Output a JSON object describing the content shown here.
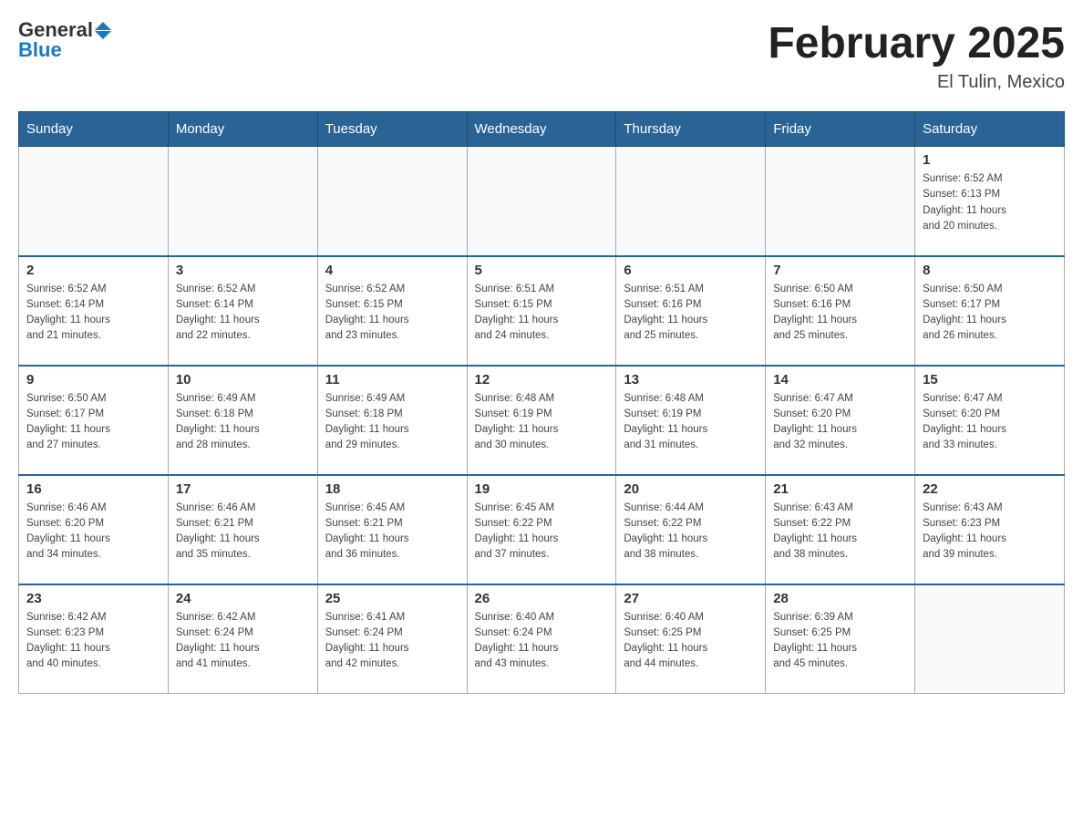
{
  "logo": {
    "general": "General",
    "blue": "Blue"
  },
  "title": "February 2025",
  "location": "El Tulin, Mexico",
  "days_of_week": [
    "Sunday",
    "Monday",
    "Tuesday",
    "Wednesday",
    "Thursday",
    "Friday",
    "Saturday"
  ],
  "weeks": [
    [
      {
        "day": "",
        "info": ""
      },
      {
        "day": "",
        "info": ""
      },
      {
        "day": "",
        "info": ""
      },
      {
        "day": "",
        "info": ""
      },
      {
        "day": "",
        "info": ""
      },
      {
        "day": "",
        "info": ""
      },
      {
        "day": "1",
        "info": "Sunrise: 6:52 AM\nSunset: 6:13 PM\nDaylight: 11 hours\nand 20 minutes."
      }
    ],
    [
      {
        "day": "2",
        "info": "Sunrise: 6:52 AM\nSunset: 6:14 PM\nDaylight: 11 hours\nand 21 minutes."
      },
      {
        "day": "3",
        "info": "Sunrise: 6:52 AM\nSunset: 6:14 PM\nDaylight: 11 hours\nand 22 minutes."
      },
      {
        "day": "4",
        "info": "Sunrise: 6:52 AM\nSunset: 6:15 PM\nDaylight: 11 hours\nand 23 minutes."
      },
      {
        "day": "5",
        "info": "Sunrise: 6:51 AM\nSunset: 6:15 PM\nDaylight: 11 hours\nand 24 minutes."
      },
      {
        "day": "6",
        "info": "Sunrise: 6:51 AM\nSunset: 6:16 PM\nDaylight: 11 hours\nand 25 minutes."
      },
      {
        "day": "7",
        "info": "Sunrise: 6:50 AM\nSunset: 6:16 PM\nDaylight: 11 hours\nand 25 minutes."
      },
      {
        "day": "8",
        "info": "Sunrise: 6:50 AM\nSunset: 6:17 PM\nDaylight: 11 hours\nand 26 minutes."
      }
    ],
    [
      {
        "day": "9",
        "info": "Sunrise: 6:50 AM\nSunset: 6:17 PM\nDaylight: 11 hours\nand 27 minutes."
      },
      {
        "day": "10",
        "info": "Sunrise: 6:49 AM\nSunset: 6:18 PM\nDaylight: 11 hours\nand 28 minutes."
      },
      {
        "day": "11",
        "info": "Sunrise: 6:49 AM\nSunset: 6:18 PM\nDaylight: 11 hours\nand 29 minutes."
      },
      {
        "day": "12",
        "info": "Sunrise: 6:48 AM\nSunset: 6:19 PM\nDaylight: 11 hours\nand 30 minutes."
      },
      {
        "day": "13",
        "info": "Sunrise: 6:48 AM\nSunset: 6:19 PM\nDaylight: 11 hours\nand 31 minutes."
      },
      {
        "day": "14",
        "info": "Sunrise: 6:47 AM\nSunset: 6:20 PM\nDaylight: 11 hours\nand 32 minutes."
      },
      {
        "day": "15",
        "info": "Sunrise: 6:47 AM\nSunset: 6:20 PM\nDaylight: 11 hours\nand 33 minutes."
      }
    ],
    [
      {
        "day": "16",
        "info": "Sunrise: 6:46 AM\nSunset: 6:20 PM\nDaylight: 11 hours\nand 34 minutes."
      },
      {
        "day": "17",
        "info": "Sunrise: 6:46 AM\nSunset: 6:21 PM\nDaylight: 11 hours\nand 35 minutes."
      },
      {
        "day": "18",
        "info": "Sunrise: 6:45 AM\nSunset: 6:21 PM\nDaylight: 11 hours\nand 36 minutes."
      },
      {
        "day": "19",
        "info": "Sunrise: 6:45 AM\nSunset: 6:22 PM\nDaylight: 11 hours\nand 37 minutes."
      },
      {
        "day": "20",
        "info": "Sunrise: 6:44 AM\nSunset: 6:22 PM\nDaylight: 11 hours\nand 38 minutes."
      },
      {
        "day": "21",
        "info": "Sunrise: 6:43 AM\nSunset: 6:22 PM\nDaylight: 11 hours\nand 38 minutes."
      },
      {
        "day": "22",
        "info": "Sunrise: 6:43 AM\nSunset: 6:23 PM\nDaylight: 11 hours\nand 39 minutes."
      }
    ],
    [
      {
        "day": "23",
        "info": "Sunrise: 6:42 AM\nSunset: 6:23 PM\nDaylight: 11 hours\nand 40 minutes."
      },
      {
        "day": "24",
        "info": "Sunrise: 6:42 AM\nSunset: 6:24 PM\nDaylight: 11 hours\nand 41 minutes."
      },
      {
        "day": "25",
        "info": "Sunrise: 6:41 AM\nSunset: 6:24 PM\nDaylight: 11 hours\nand 42 minutes."
      },
      {
        "day": "26",
        "info": "Sunrise: 6:40 AM\nSunset: 6:24 PM\nDaylight: 11 hours\nand 43 minutes."
      },
      {
        "day": "27",
        "info": "Sunrise: 6:40 AM\nSunset: 6:25 PM\nDaylight: 11 hours\nand 44 minutes."
      },
      {
        "day": "28",
        "info": "Sunrise: 6:39 AM\nSunset: 6:25 PM\nDaylight: 11 hours\nand 45 minutes."
      },
      {
        "day": "",
        "info": ""
      }
    ]
  ]
}
